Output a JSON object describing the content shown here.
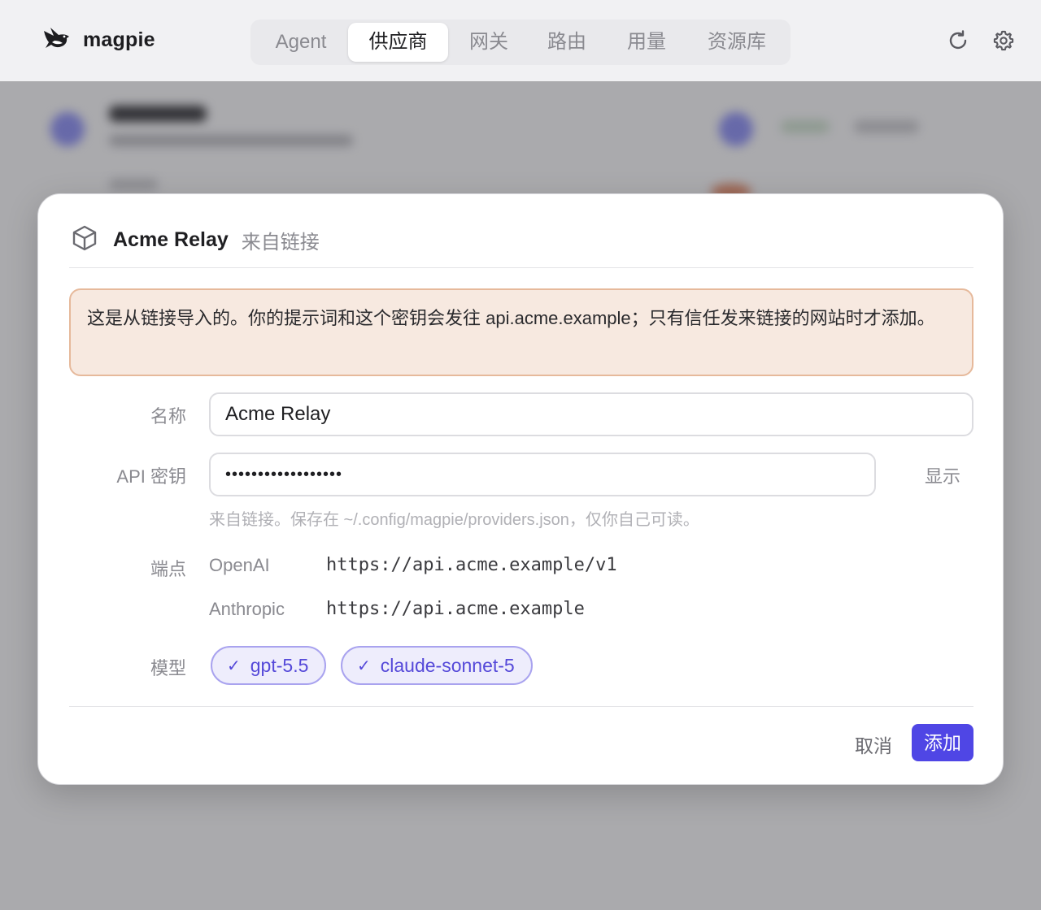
{
  "app": {
    "name": "magpie"
  },
  "nav": {
    "tabs": [
      {
        "label": "Agent",
        "active": false
      },
      {
        "label": "供应商",
        "active": true
      },
      {
        "label": "网关",
        "active": false
      },
      {
        "label": "路由",
        "active": false
      },
      {
        "label": "用量",
        "active": false
      },
      {
        "label": "资源库",
        "active": false
      }
    ]
  },
  "header_icons": [
    "refresh-icon",
    "gear-icon"
  ],
  "modal": {
    "icon": "cube-icon",
    "title": "Acme Relay",
    "subtitle": "来自链接",
    "warning": "这是从链接导入的。你的提示词和这个密钥会发往 api.acme.example；只有信任发来链接的网站时才添加。",
    "name_label": "名称",
    "name_value": "Acme Relay",
    "api_key_label": "API 密钥",
    "api_key_value": "••••••••••••••••••",
    "show_label": "显示",
    "api_key_hint": "来自链接。保存在 ~/.config/magpie/providers.json，仅你自己可读。",
    "endpoints_label": "端点",
    "endpoints": [
      {
        "kind": "OpenAI",
        "url": "https://api.acme.example/v1"
      },
      {
        "kind": "Anthropic",
        "url": "https://api.acme.example"
      }
    ],
    "models_label": "模型",
    "models": [
      {
        "check": "✓",
        "name": "gpt-5.5"
      },
      {
        "check": "✓",
        "name": "claude-sonnet-5"
      }
    ],
    "cancel_label": "取消",
    "add_label": "添加"
  },
  "colors": {
    "accent": "#4f46e5",
    "chip_text": "#5549d9",
    "chip_bg": "#eeedfc",
    "warning_bg": "#f7e9e0",
    "warning_border": "#e6b99b"
  }
}
